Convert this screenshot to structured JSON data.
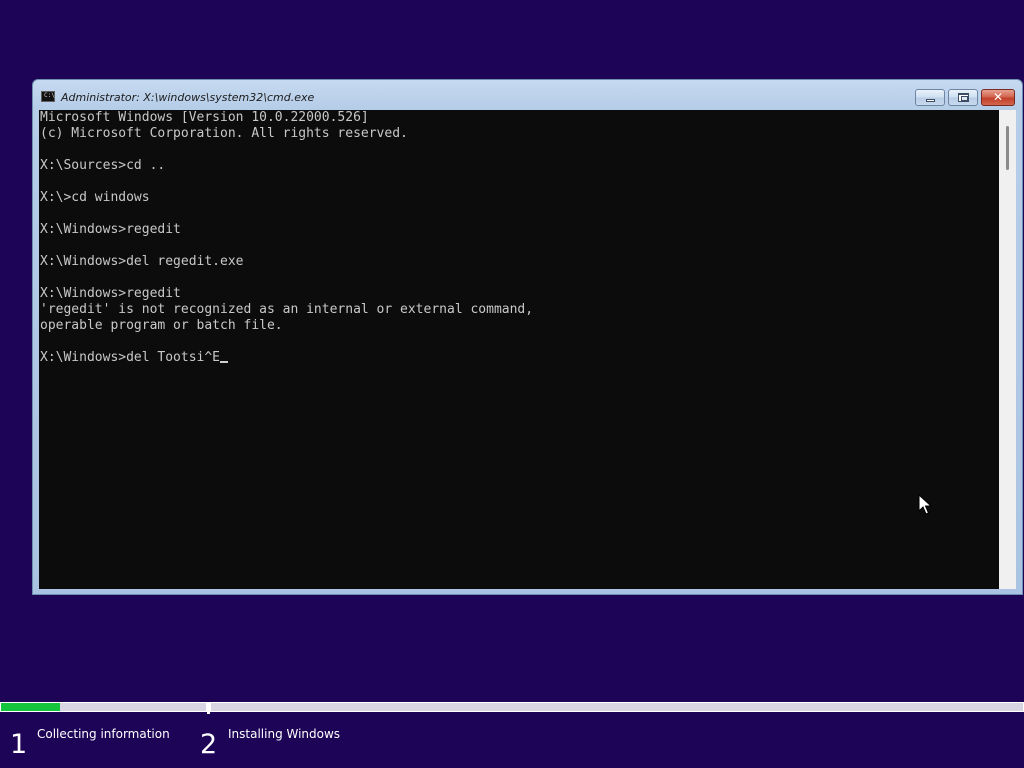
{
  "cmd_window": {
    "title": "Administrator: X:\\windows\\system32\\cmd.exe",
    "icon": "console-icon",
    "icon_text": "C:\\",
    "close_glyph": "✕"
  },
  "console": {
    "lines": [
      "Microsoft Windows [Version 10.0.22000.526]",
      "(c) Microsoft Corporation. All rights reserved.",
      "",
      "X:\\Sources>cd ..",
      "",
      "X:\\>cd windows",
      "",
      "X:\\Windows>regedit",
      "",
      "X:\\Windows>del regedit.exe",
      "",
      "X:\\Windows>regedit",
      "'regedit' is not recognized as an internal or external command,",
      "operable program or batch file.",
      "",
      "X:\\Windows>del Tootsi^E"
    ],
    "text_color": "#c8c8c8",
    "background_color": "#0c0c0c"
  },
  "setup": {
    "steps": [
      {
        "number": "1",
        "label": "Collecting information",
        "progress": 0.29,
        "fill_color": "#16c33c"
      },
      {
        "number": "2",
        "label": "Installing Windows",
        "progress": 0
      }
    ]
  },
  "colors": {
    "desktop_background": "#1d0457",
    "progress_track": "#d8d4e2"
  }
}
